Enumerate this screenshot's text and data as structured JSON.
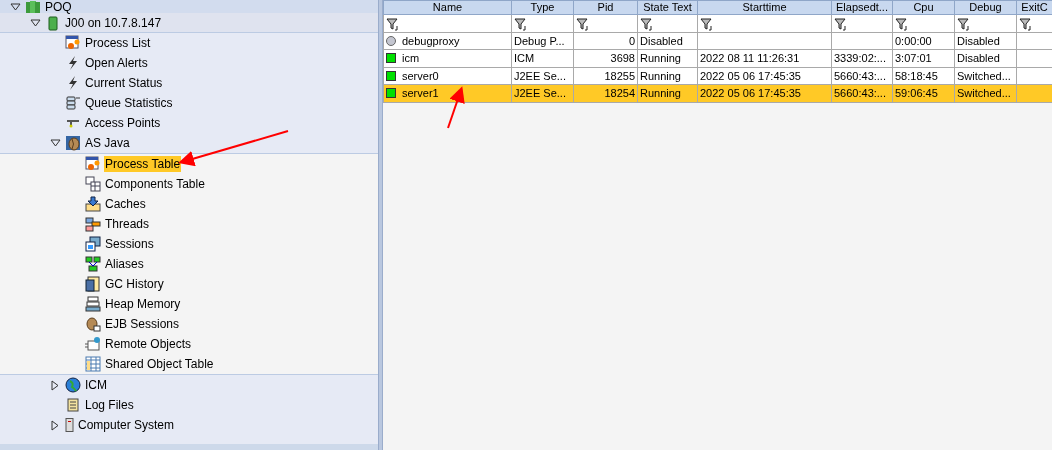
{
  "tree": [
    {
      "label": "POQ",
      "expanded": true,
      "selected": false,
      "children": [
        {
          "label": "J00 on 10.7.8.147",
          "expanded": true,
          "selected": false,
          "children": [
            {
              "label": "Process List",
              "selected": false
            },
            {
              "label": "Open Alerts",
              "selected": false
            },
            {
              "label": "Current Status",
              "selected": false
            },
            {
              "label": "Queue Statistics",
              "selected": false
            },
            {
              "label": "Access Points",
              "selected": false
            },
            {
              "label": "AS Java",
              "expanded": true,
              "selected": false,
              "children": [
                {
                  "label": "Process Table",
                  "selected": true
                },
                {
                  "label": "Components Table",
                  "selected": false
                },
                {
                  "label": "Caches",
                  "selected": false
                },
                {
                  "label": "Threads",
                  "selected": false
                },
                {
                  "label": "Sessions",
                  "selected": false
                },
                {
                  "label": "Aliases",
                  "selected": false
                },
                {
                  "label": "GC History",
                  "selected": false
                },
                {
                  "label": "Heap Memory",
                  "selected": false
                },
                {
                  "label": "EJB Sessions",
                  "selected": false
                },
                {
                  "label": "Remote Objects",
                  "selected": false
                },
                {
                  "label": "Shared Object Table",
                  "selected": false
                }
              ]
            },
            {
              "label": "ICM",
              "expanded": false,
              "selected": false
            },
            {
              "label": "Log Files",
              "selected": false
            },
            {
              "label": "Computer System",
              "expanded": false,
              "selected": false
            }
          ]
        }
      ]
    }
  ],
  "table": {
    "columns": [
      "Name",
      "Type",
      "Pid",
      "State Text",
      "Starttime",
      "Elapsedt...",
      "Cpu",
      "Debug",
      "ExitC"
    ],
    "rows": [
      {
        "kind": "inactive",
        "color": "#c4c6d0",
        "selected": false,
        "cells": [
          "debugproxy",
          "Debug P...",
          "0",
          "Disabled",
          "",
          "",
          "0:00:00",
          "Disabled",
          ""
        ]
      },
      {
        "kind": "active",
        "color": "#00e000",
        "selected": false,
        "cells": [
          "icm",
          "ICM",
          "3698",
          "Running",
          "2022 08 11 11:26:31",
          "3339:02:...",
          "3:07:01",
          "Disabled",
          ""
        ]
      },
      {
        "kind": "active",
        "color": "#00e000",
        "selected": false,
        "cells": [
          "server0",
          "J2EE Se...",
          "18255",
          "Running",
          "2022 05 06 17:45:35",
          "5660:43:...",
          "58:18:45",
          "Switched...",
          ""
        ]
      },
      {
        "kind": "active",
        "color": "#00e000",
        "selected": true,
        "cells": [
          "server1",
          "J2EE Se...",
          "18254",
          "Running",
          "2022 05 06 17:45:35",
          "5660:43:...",
          "59:06:45",
          "Switched...",
          ""
        ]
      }
    ]
  }
}
